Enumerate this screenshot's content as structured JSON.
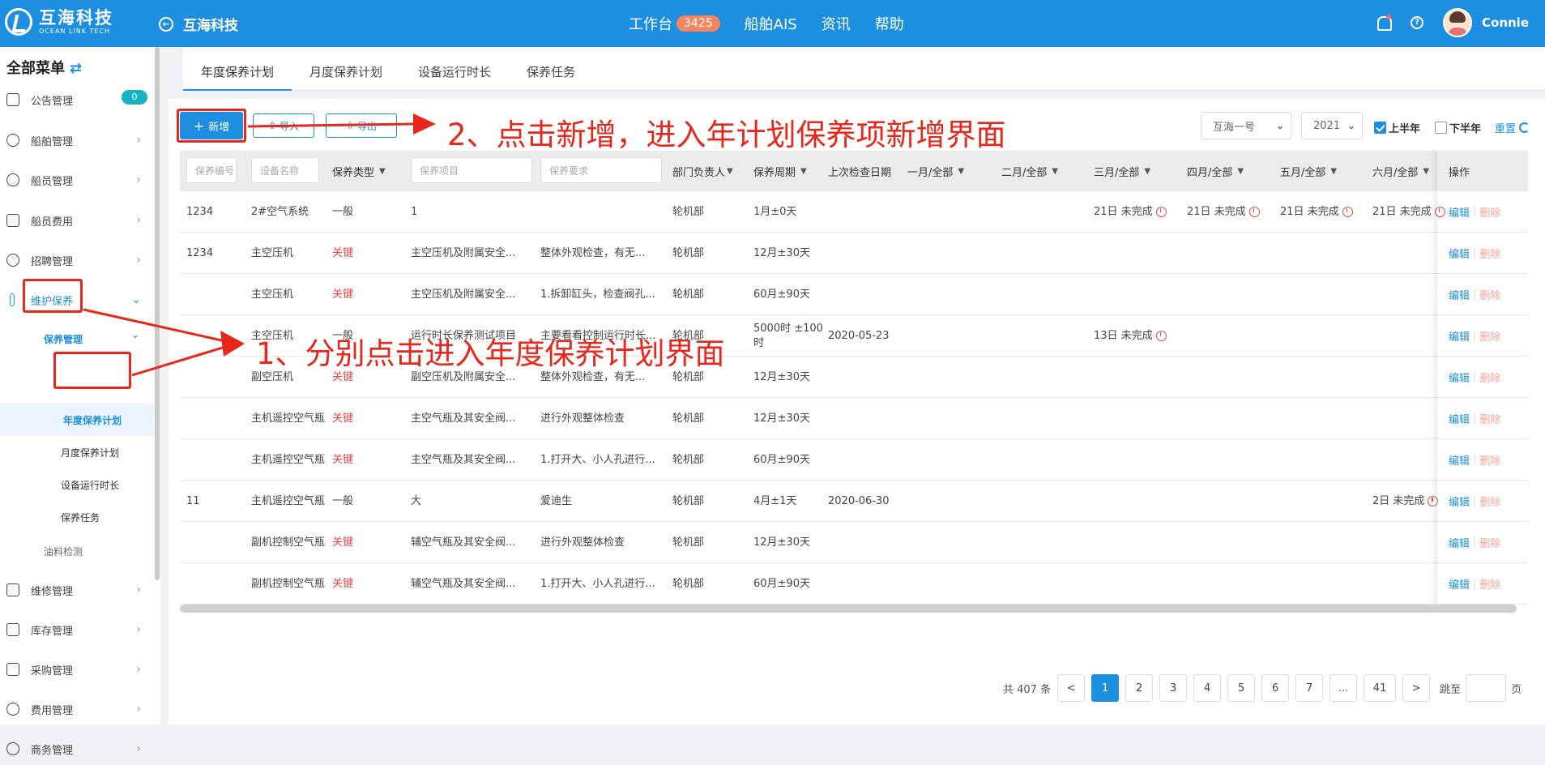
{
  "header": {
    "logo_cn": "互海科技",
    "logo_en": "OCEAN LINK TECH",
    "back_title": "互海科技",
    "nav": [
      {
        "label": "工作台",
        "badge": "3425"
      },
      {
        "label": "船舶AIS"
      },
      {
        "label": "资讯"
      },
      {
        "label": "帮助"
      }
    ],
    "help_glyph": "?",
    "user": "Connie"
  },
  "sidebar": {
    "title": "全部菜单",
    "swap_glyph": "⇄",
    "items": [
      {
        "label": "公告管理",
        "badge": "0"
      },
      {
        "label": "船舶管理"
      },
      {
        "label": "船员管理"
      },
      {
        "label": "船员费用"
      },
      {
        "label": "招聘管理"
      },
      {
        "label": "维护保养"
      },
      {
        "label": "维修管理"
      },
      {
        "label": "库存管理"
      },
      {
        "label": "采购管理"
      },
      {
        "label": "费用管理"
      },
      {
        "label": "商务管理"
      }
    ],
    "sub_group": "保养管理",
    "sub_items": [
      "年度保养计划",
      "月度保养计划",
      "设备运行时长",
      "保养任务"
    ],
    "oil": "油料检测"
  },
  "tabs": [
    "年度保养计划",
    "月度保养计划",
    "设备运行时长",
    "保养任务"
  ],
  "toolbar": {
    "add": "新增",
    "import": "导入",
    "export": "导出",
    "ship": "互海一号",
    "year": "2021",
    "first_half": "上半年",
    "second_half": "下半年",
    "reset": "重置"
  },
  "table": {
    "filters": {
      "code": "保养编号",
      "device": "设备名称",
      "item": "保养项目",
      "req": "保养要求"
    },
    "headers": {
      "type": "保养类型",
      "dept": "部门负责人",
      "cycle": "保养周期",
      "last": "上次检查日期",
      "m1": "一月/全部",
      "m2": "二月/全部",
      "m3": "三月/全部",
      "m4": "四月/全部",
      "m5": "五月/全部",
      "m6": "六月/全部",
      "op": "操作"
    },
    "rows": [
      {
        "code": "1234",
        "device": "2#空气系统",
        "type": "一般",
        "item": "1",
        "req": "",
        "dept": "轮机部",
        "cycle": "1月±0天",
        "last": "",
        "m3": "21日 未完成",
        "m4": "21日 未完成",
        "m5": "21日 未完成",
        "m6": "21日 未完成"
      },
      {
        "code": "1234",
        "device": "主空压机",
        "type": "关键",
        "item": "主空压机及附属安全...",
        "req": "整体外观检查，有无...",
        "dept": "轮机部",
        "cycle": "12月±30天",
        "last": "",
        "m3": "",
        "m4": "",
        "m5": "",
        "m6": ""
      },
      {
        "code": "",
        "device": "主空压机",
        "type": "关键",
        "item": "主空压机及附属安全...",
        "req": "1.拆卸缸头，检查阀孔...",
        "dept": "轮机部",
        "cycle": "60月±90天",
        "last": "",
        "m3": "",
        "m4": "",
        "m5": "",
        "m6": ""
      },
      {
        "code": "",
        "device": "主空压机",
        "type": "一般",
        "item": "运行时长保养测试项目",
        "req": "主要看看控制运行时长...",
        "dept": "轮机部",
        "cycle": "5000时 ±100时",
        "last": "2020-05-23",
        "m3": "13日 未完成",
        "m4": "",
        "m5": "",
        "m6": ""
      },
      {
        "code": "",
        "device": "副空压机",
        "type": "关键",
        "item": "副空压机及附属安全...",
        "req": "整体外观检查，有无...",
        "dept": "轮机部",
        "cycle": "12月±30天",
        "last": "",
        "m3": "",
        "m4": "",
        "m5": "",
        "m6": ""
      },
      {
        "code": "",
        "device": "主机遥控空气瓶",
        "type": "关键",
        "item": "主空气瓶及其安全阀...",
        "req": "进行外观整体检查",
        "dept": "轮机部",
        "cycle": "12月±30天",
        "last": "",
        "m3": "",
        "m4": "",
        "m5": "",
        "m6": ""
      },
      {
        "code": "",
        "device": "主机遥控空气瓶",
        "type": "关键",
        "item": "主空气瓶及其安全阀...",
        "req": "1.打开大、小人孔进行...",
        "dept": "轮机部",
        "cycle": "60月±90天",
        "last": "",
        "m3": "",
        "m4": "",
        "m5": "",
        "m6": ""
      },
      {
        "code": "11",
        "device": "主机遥控空气瓶",
        "type": "一般",
        "item": "大",
        "req": "爱迪生",
        "dept": "轮机部",
        "cycle": "4月±1天",
        "last": "2020-06-30",
        "m3": "",
        "m4": "",
        "m5": "",
        "m6": "2日 未完成"
      },
      {
        "code": "",
        "device": "副机控制空气瓶",
        "type": "关键",
        "item": "辅空气瓶及其安全阀...",
        "req": "进行外观整体检查",
        "dept": "轮机部",
        "cycle": "12月±30天",
        "last": "",
        "m3": "",
        "m4": "",
        "m5": "",
        "m6": ""
      },
      {
        "code": "",
        "device": "副机控制空气瓶",
        "type": "关键",
        "item": "辅空气瓶及其安全阀...",
        "req": "1.打开大、小人孔进行...",
        "dept": "轮机部",
        "cycle": "60月±90天",
        "last": "",
        "m3": "",
        "m4": "",
        "m5": "",
        "m6": ""
      }
    ],
    "edit": "编辑",
    "delete": "删除"
  },
  "pagination": {
    "total": "共 407 条",
    "prev": "<",
    "next": ">",
    "pages": [
      "1",
      "2",
      "3",
      "4",
      "5",
      "6",
      "7",
      "...",
      "41"
    ],
    "current": "1",
    "jump_label": "跳至",
    "page_suffix": "页"
  },
  "annotations": {
    "step1": "1、分别点击进入年度保养计划界面",
    "step2": "2、点击新增，进入年计划保养项新增界面"
  },
  "colors": {
    "brand": "#1c8fe0",
    "annotation": "#e8261b",
    "critical": "#f04545"
  }
}
